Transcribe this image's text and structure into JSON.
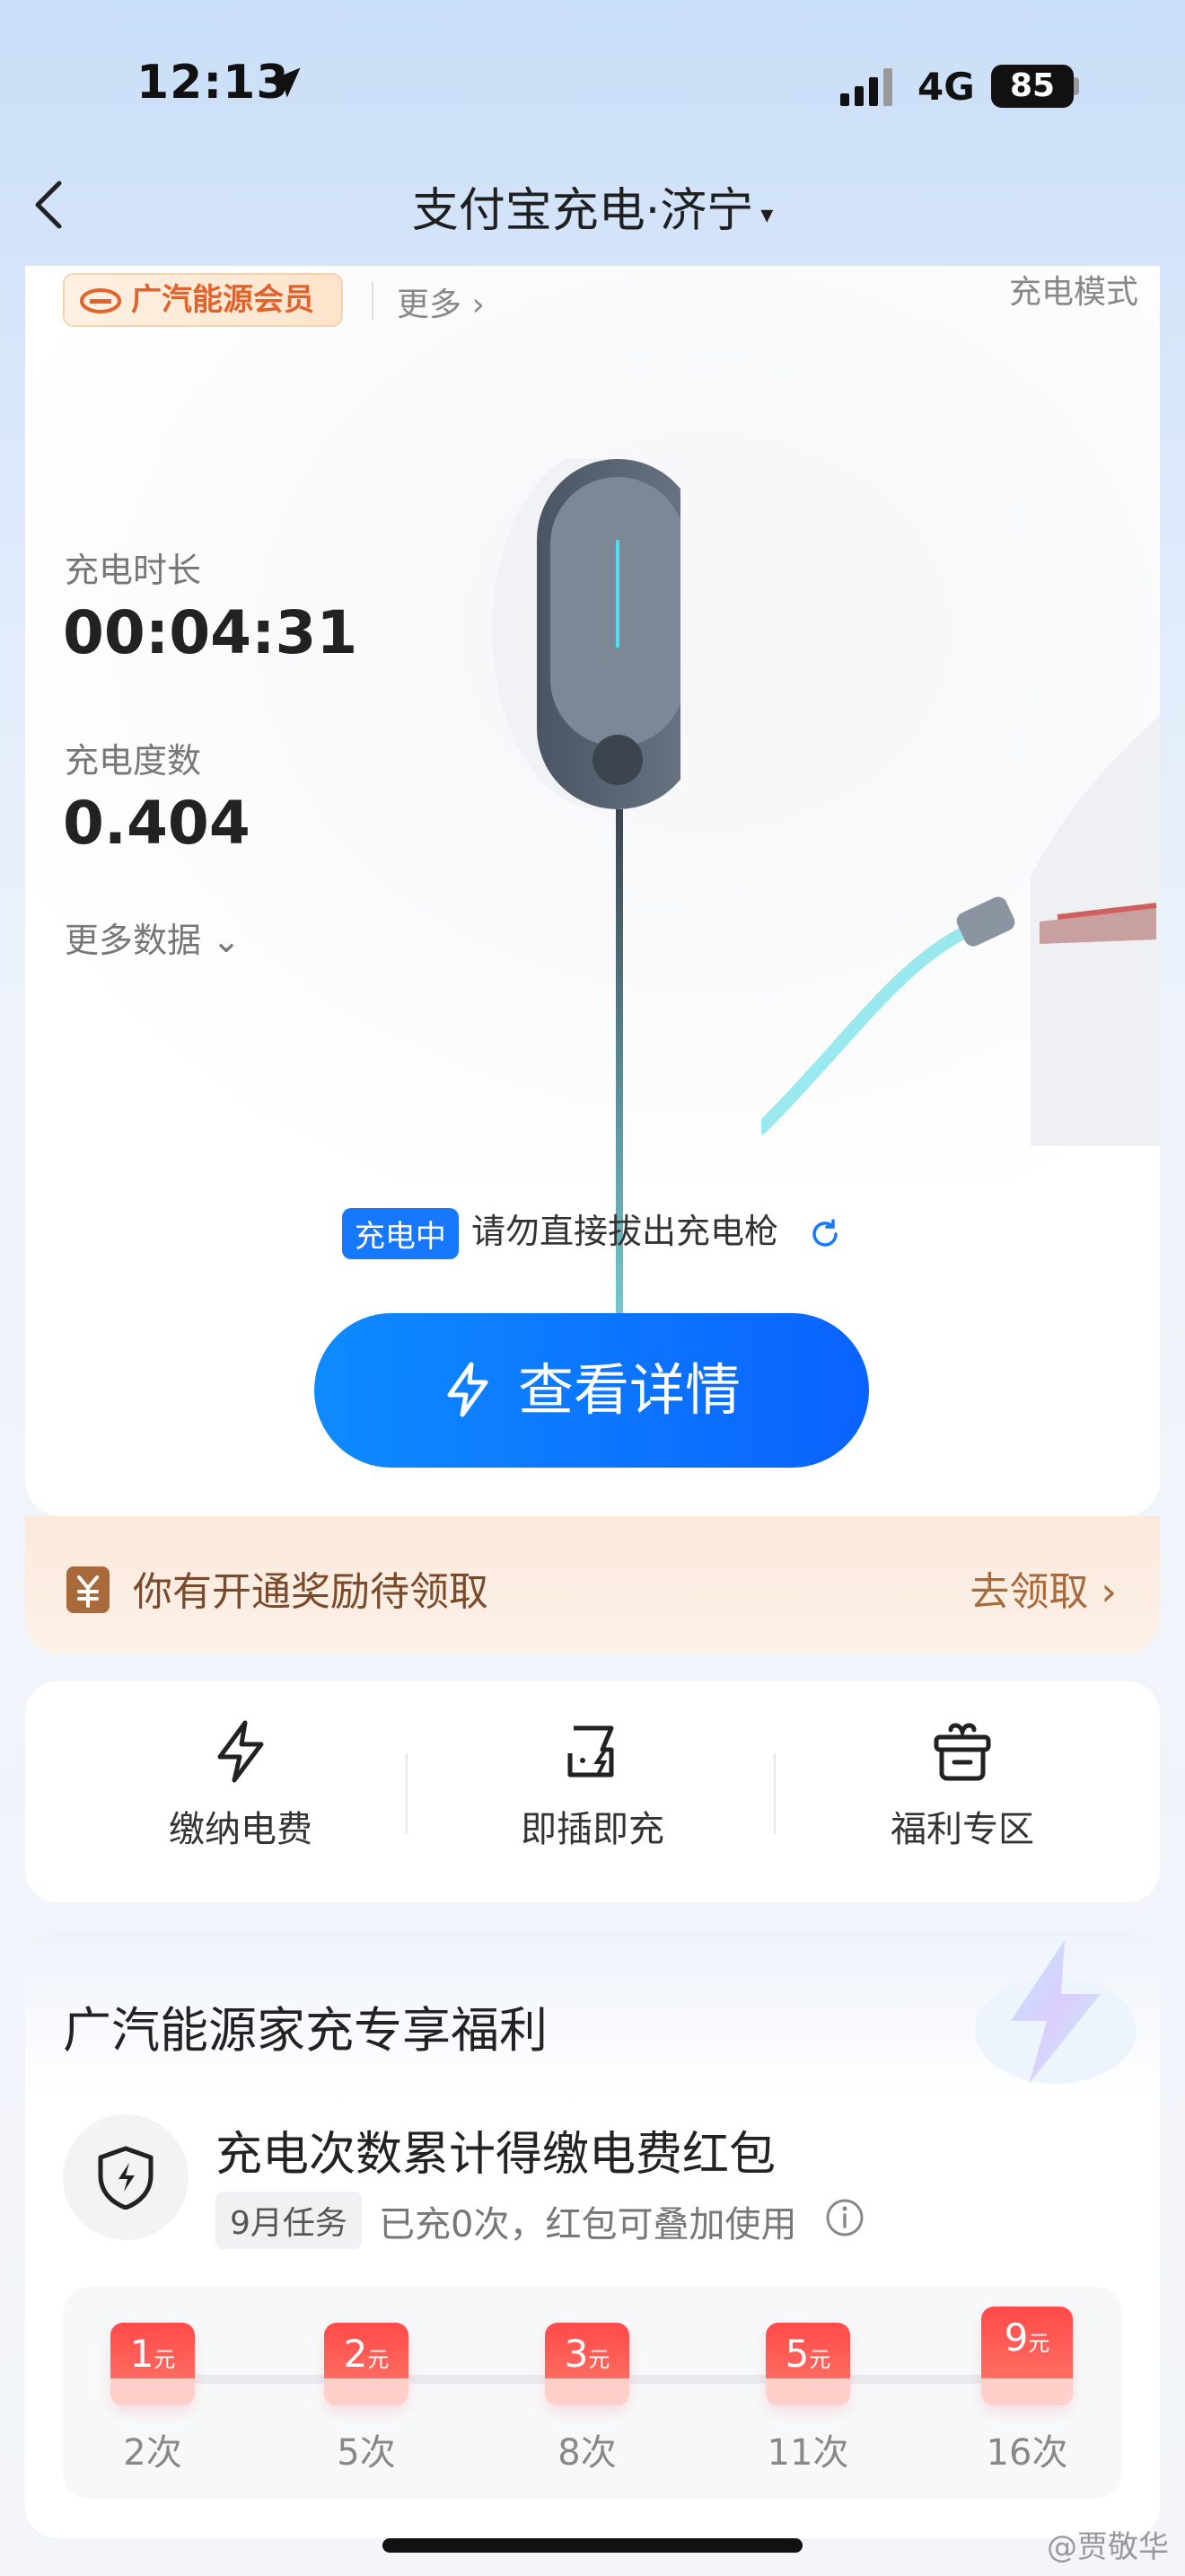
{
  "status_bar": {
    "time": "12:13",
    "network": "4G",
    "battery": "85"
  },
  "nav": {
    "title": "支付宝充电·济宁",
    "caret": "▾"
  },
  "hero": {
    "member_badge": "广汽能源会员",
    "more": "更多 ›",
    "mode": "充电模式",
    "duration_label": "充电时长",
    "duration_value": "00:04:31",
    "energy_label": "充电度数",
    "energy_value": "0.404",
    "more_data": "更多数据 ⌄"
  },
  "charging_status": {
    "chip": "充电中",
    "message": "请勿直接拔出充电枪"
  },
  "detail_button": {
    "label": "查看详情"
  },
  "reward_banner": {
    "text": "你有开通奖励待领取",
    "action": "去领取 ›"
  },
  "quick_actions": [
    {
      "label": "缴纳电费",
      "icon": "bolt-icon"
    },
    {
      "label": "即插即充",
      "icon": "plug-charge-icon"
    },
    {
      "label": "福利专区",
      "icon": "gift-basket-icon"
    }
  ],
  "benefits": {
    "title": "广汽能源家充专享福利",
    "task_title": "充电次数累计得缴电费红包",
    "task_chip": "9月任务",
    "task_desc": "已充0次，红包可叠加使用",
    "steps": [
      {
        "amount": "1",
        "unit": "元",
        "label": "2次"
      },
      {
        "amount": "2",
        "unit": "元",
        "label": "5次"
      },
      {
        "amount": "3",
        "unit": "元",
        "label": "8次"
      },
      {
        "amount": "5",
        "unit": "元",
        "label": "11次"
      },
      {
        "amount": "9",
        "unit": "元",
        "label": "16次"
      }
    ]
  },
  "watermark": "@贾敬华",
  "colors": {
    "accent": "#1677ff",
    "reward_text": "#7a4a2a",
    "badge_orange": "#e2622c",
    "envelope_red": "#ff4a4a"
  }
}
